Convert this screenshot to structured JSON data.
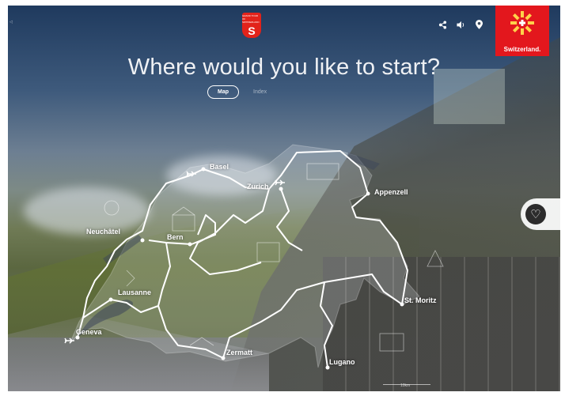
{
  "header": {
    "logo_text": "GRAND TOUR OF SWITZERLAND",
    "share_icon": "share-icon",
    "sound_icon": "speaker-icon",
    "location_icon": "map-pin-icon",
    "brand_name": "Switzerland.",
    "brand_color": "#e3171d"
  },
  "headline": "Where would you like to start?",
  "view_toggle": {
    "map_label": "Map",
    "index_label": "Index",
    "selected": "Map"
  },
  "favorite_icon": "heart-icon",
  "cities": [
    {
      "name": "Basel"
    },
    {
      "name": "Zurich"
    },
    {
      "name": "Appenzell"
    },
    {
      "name": "Neuchâtel"
    },
    {
      "name": "Bern"
    },
    {
      "name": "Lausanne"
    },
    {
      "name": "St. Moritz"
    },
    {
      "name": "Geneva"
    },
    {
      "name": "Zermatt"
    },
    {
      "name": "Lugano"
    }
  ],
  "airports": [
    "Basel",
    "Zurich",
    "Geneva"
  ],
  "scale_label": "10km"
}
